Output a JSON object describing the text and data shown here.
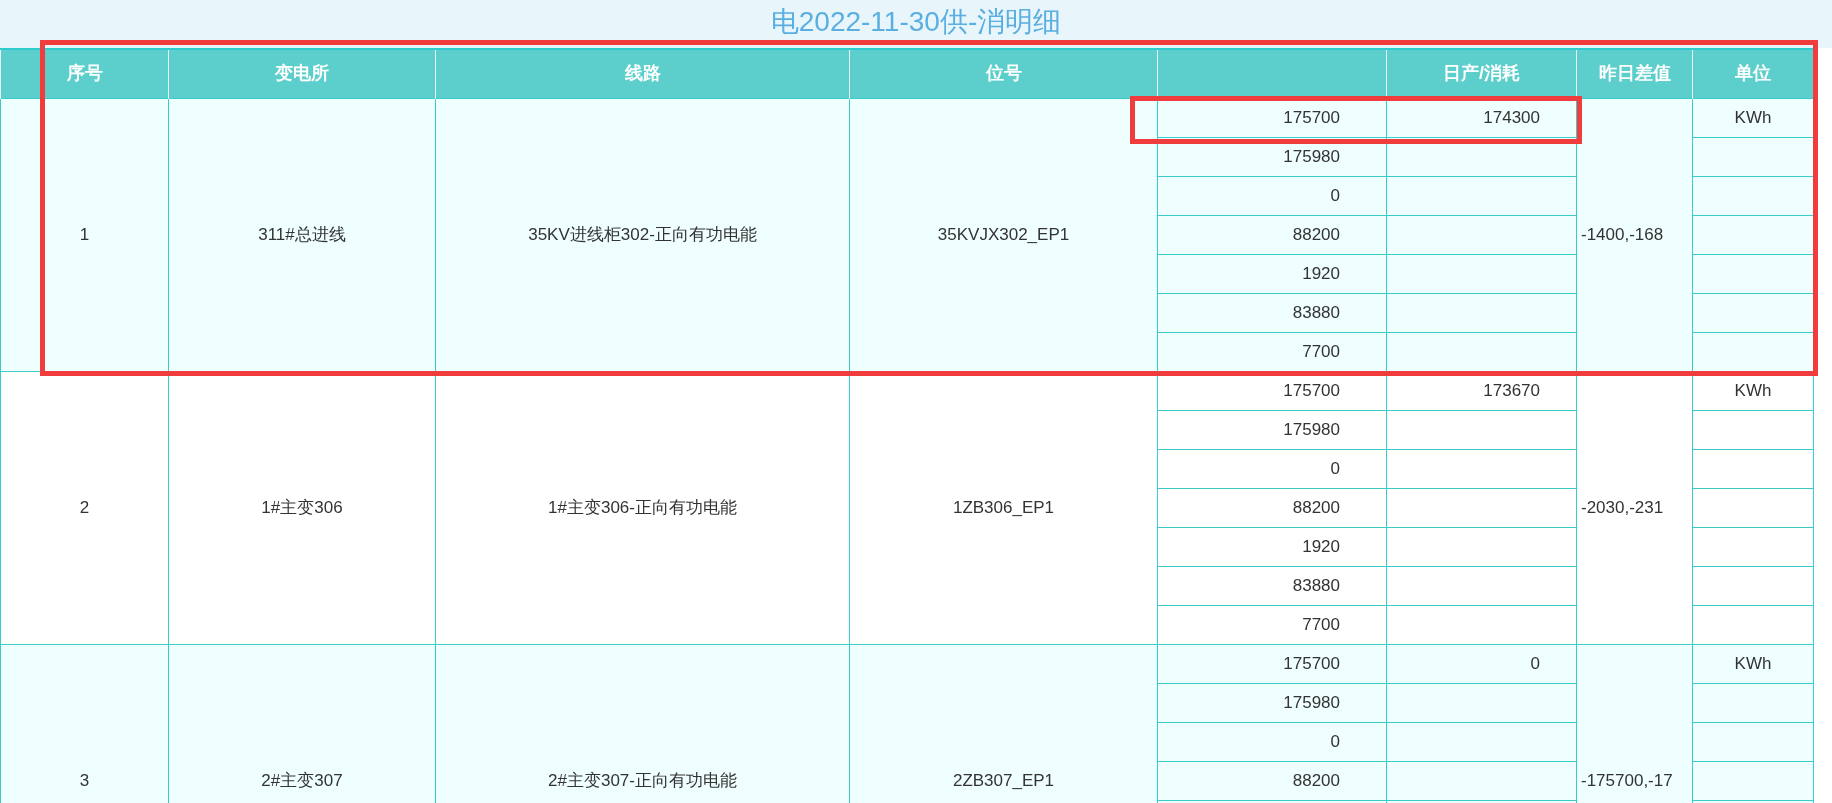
{
  "title": "电2022-11-30供-消明细",
  "table": {
    "columns": [
      "序号",
      "变电所",
      "线路",
      "位号",
      "",
      "日产/消耗",
      "昨日差值",
      "单位"
    ],
    "rows": [
      {
        "index": "1",
        "substation": "311#总进线",
        "line": "35KV进线柜302-正向有功电能",
        "tag": "35KVJX302_EP1",
        "readings": [
          "175700",
          "175980",
          "0",
          "88200",
          "1920",
          "83880",
          "7700"
        ],
        "daily": "174300",
        "diff": "-1400,-168",
        "unit": "KWh"
      },
      {
        "index": "2",
        "substation": "1#主变306",
        "line": "1#主变306-正向有功电能",
        "tag": "1ZB306_EP1",
        "readings": [
          "175700",
          "175980",
          "0",
          "88200",
          "1920",
          "83880",
          "7700"
        ],
        "daily": "173670",
        "diff": "-2030,-231",
        "unit": "KWh"
      },
      {
        "index": "3",
        "substation": "2#主变307",
        "line": "2#主变307-正向有功电能",
        "tag": "2ZB307_EP1",
        "readings": [
          "175700",
          "175980",
          "0",
          "88200"
        ],
        "daily": "0",
        "diff": "-175700,-17",
        "unit": "KWh"
      }
    ]
  }
}
